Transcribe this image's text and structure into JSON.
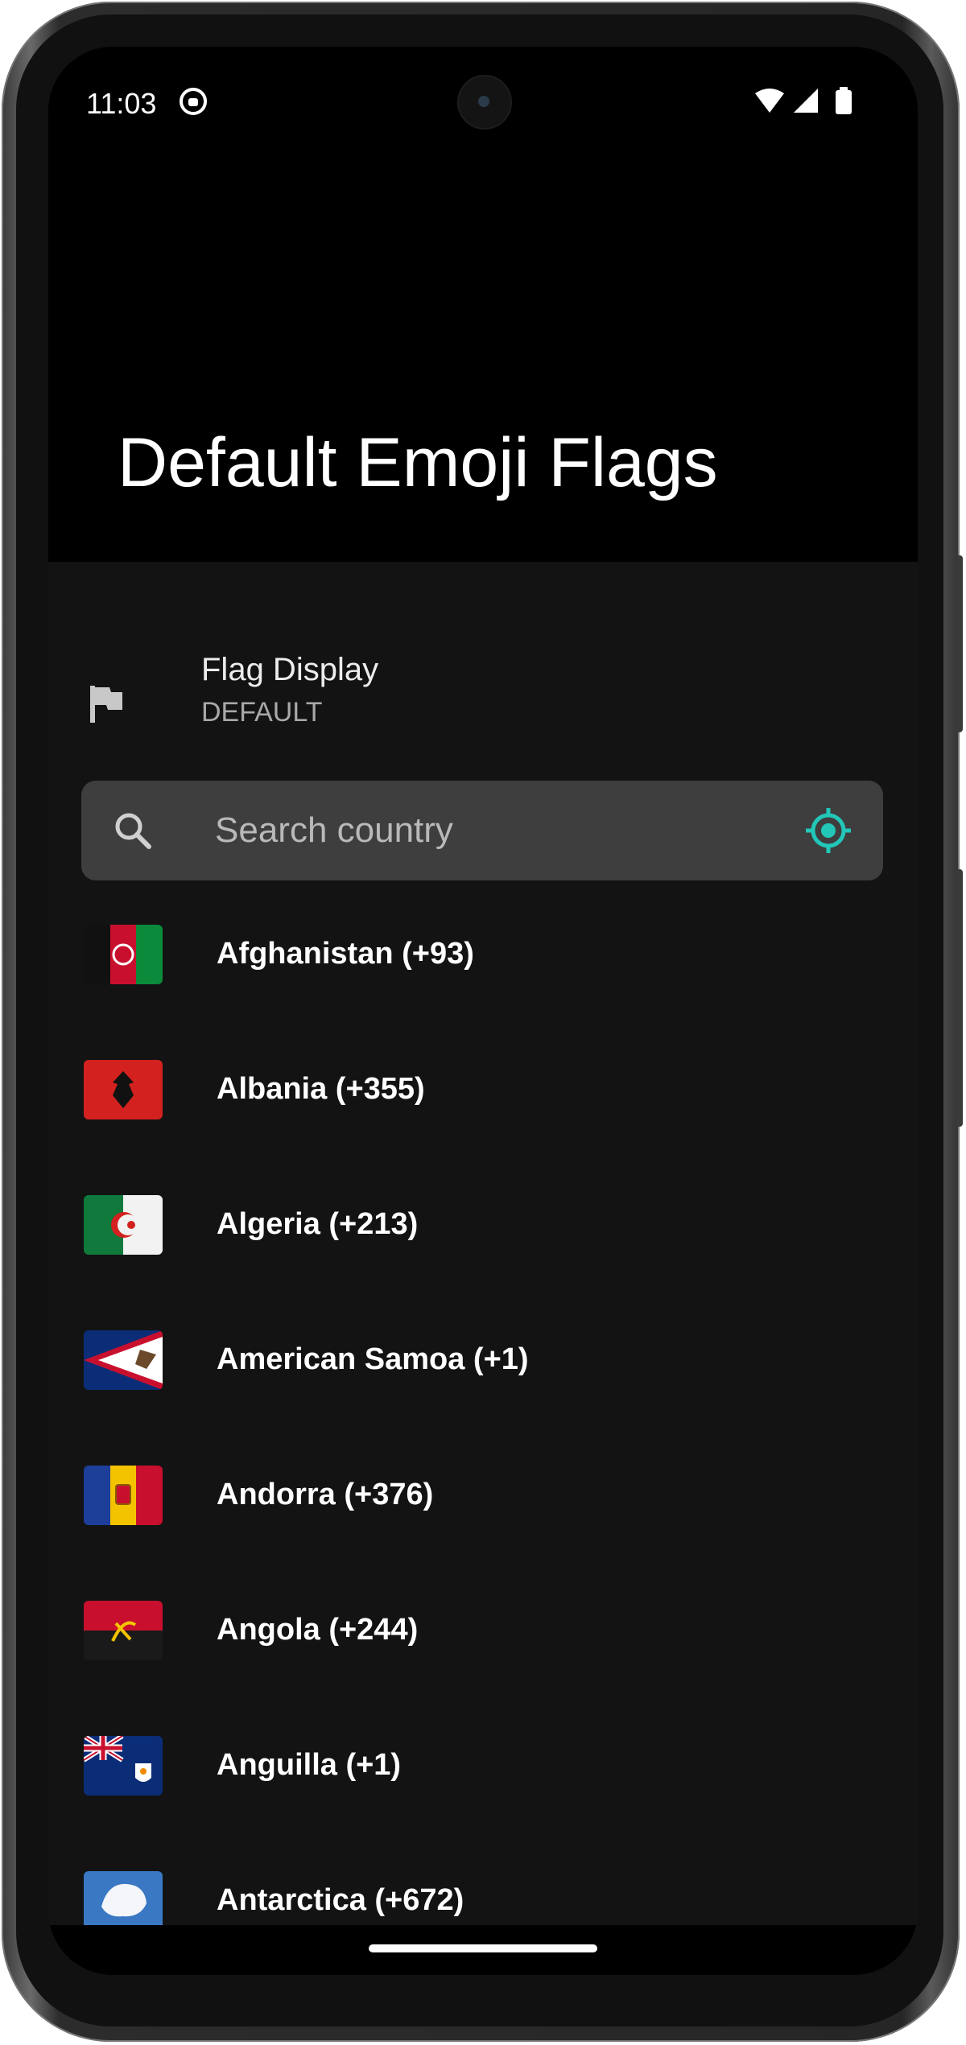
{
  "status_bar": {
    "time": "11:03",
    "icons": [
      "app-notification-icon",
      "wifi-icon",
      "cellular-signal-icon",
      "battery-icon"
    ]
  },
  "header": {
    "title": "Default Emoji Flags"
  },
  "preference": {
    "icon": "flag-icon",
    "title": "Flag Display",
    "summary": "DEFAULT"
  },
  "search": {
    "placeholder": "Search country",
    "value": "",
    "leading_icon": "search-icon",
    "trailing_icon": "my-location-icon"
  },
  "countries": [
    {
      "label": "Afghanistan (+93)",
      "flag": "afghanistan"
    },
    {
      "label": "Albania (+355)",
      "flag": "albania"
    },
    {
      "label": "Algeria (+213)",
      "flag": "algeria"
    },
    {
      "label": "American Samoa (+1)",
      "flag": "american-samoa"
    },
    {
      "label": "Andorra (+376)",
      "flag": "andorra"
    },
    {
      "label": "Angola (+244)",
      "flag": "angola"
    },
    {
      "label": "Anguilla (+1)",
      "flag": "anguilla"
    },
    {
      "label": "Antarctica (+672)",
      "flag": "antarctica"
    }
  ],
  "colors": {
    "background": "#131313",
    "header_background": "#000000",
    "search_background": "#3e3e3e",
    "accent": "#22c7b8",
    "text_primary": "#ffffff",
    "text_secondary": "#a9a9a9"
  }
}
